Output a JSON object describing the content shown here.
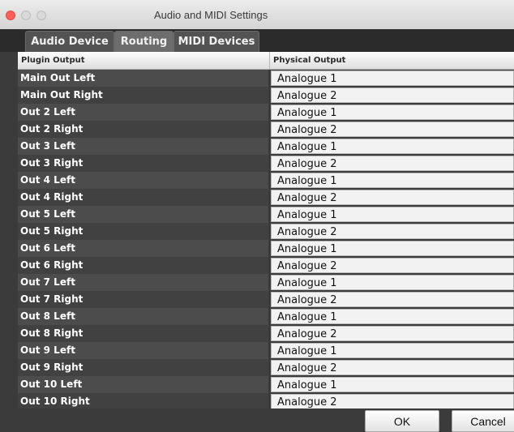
{
  "window": {
    "title": "Audio and MIDI Settings"
  },
  "tabs": [
    {
      "label": "Audio Device"
    },
    {
      "label": "Routing",
      "active": true
    },
    {
      "label": "MIDI Devices"
    }
  ],
  "table": {
    "columns": [
      "Plugin Output",
      "Physical Output"
    ],
    "rows": [
      {
        "plugin": "Main Out Left",
        "physical": "Analogue 1"
      },
      {
        "plugin": "Main Out Right",
        "physical": "Analogue 2"
      },
      {
        "plugin": "Out 2 Left",
        "physical": "Analogue 1"
      },
      {
        "plugin": "Out 2 Right",
        "physical": "Analogue 2"
      },
      {
        "plugin": "Out 3 Left",
        "physical": "Analogue 1"
      },
      {
        "plugin": "Out 3 Right",
        "physical": "Analogue 2"
      },
      {
        "plugin": "Out 4 Left",
        "physical": "Analogue 1"
      },
      {
        "plugin": "Out 4 Right",
        "physical": "Analogue 2"
      },
      {
        "plugin": "Out 5 Left",
        "physical": "Analogue 1"
      },
      {
        "plugin": "Out 5 Right",
        "physical": "Analogue 2"
      },
      {
        "plugin": "Out 6 Left",
        "physical": "Analogue 1"
      },
      {
        "plugin": "Out 6 Right",
        "physical": "Analogue 2"
      },
      {
        "plugin": "Out 7 Left",
        "physical": "Analogue 1"
      },
      {
        "plugin": "Out 7 Right",
        "physical": "Analogue 2"
      },
      {
        "plugin": "Out 8 Left",
        "physical": "Analogue 1"
      },
      {
        "plugin": "Out 8 Right",
        "physical": "Analogue 2"
      },
      {
        "plugin": "Out 9 Left",
        "physical": "Analogue 1"
      },
      {
        "plugin": "Out 9 Right",
        "physical": "Analogue 2"
      },
      {
        "plugin": "Out 10 Left",
        "physical": "Analogue 1"
      },
      {
        "plugin": "Out 10 Right",
        "physical": "Analogue 2"
      }
    ]
  },
  "buttons": {
    "ok": "OK",
    "cancel": "Cancel"
  },
  "colors": {
    "close": "#fc5f57",
    "background": "#3b3b3b"
  }
}
